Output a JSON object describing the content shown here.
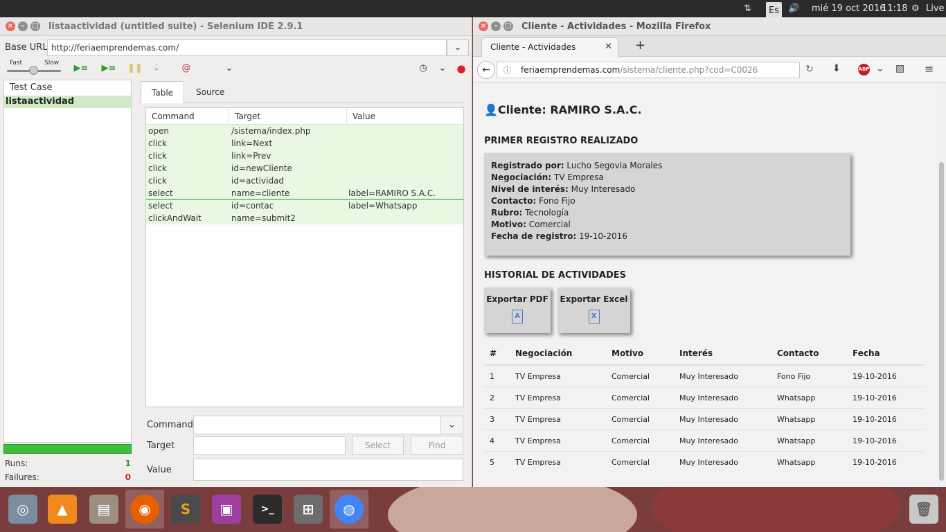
{
  "top_panel": {
    "keyboard": "Es",
    "date": "mié 19 oct 2016",
    "time": "11:18",
    "live": "Live"
  },
  "selenium": {
    "title": "listaactividad (untitled suite) - Selenium IDE 2.9.1",
    "base_url_label": "Base URL",
    "base_url": "http://feriaemprendemas.com/",
    "speed_fast": "Fast",
    "speed_slow": "Slow",
    "testcase_header": "Test Case",
    "testcase_item": "listaactividad",
    "runs_label": "Runs:",
    "runs_value": "1",
    "failures_label": "Failures:",
    "failures_value": "0",
    "tabs": [
      {
        "label": "Table"
      },
      {
        "label": "Source"
      }
    ],
    "columns": [
      "Command",
      "Target",
      "Value"
    ],
    "commands": [
      {
        "command": "open",
        "target": "/sistema/index.php",
        "value": ""
      },
      {
        "command": "click",
        "target": "link=Next",
        "value": ""
      },
      {
        "command": "click",
        "target": "link=Prev",
        "value": ""
      },
      {
        "command": "click",
        "target": "id=newCliente",
        "value": ""
      },
      {
        "command": "click",
        "target": "id=actividad",
        "value": ""
      },
      {
        "command": "select",
        "target": "name=cliente",
        "value": "label=RAMIRO S.A.C."
      },
      {
        "command": "select",
        "target": "id=contac",
        "value": "label=Whatsapp"
      },
      {
        "command": "clickAndWait",
        "target": "name=submit2",
        "value": ""
      }
    ],
    "form": {
      "command_label": "Command",
      "target_label": "Target",
      "value_label": "Value",
      "select_button": "Select",
      "find_button": "Find"
    }
  },
  "firefox": {
    "title": "Cliente - Actividades - Mozilla Firefox",
    "tab_label": "Cliente - Actividades",
    "url_host": "feriaemprendemas.com",
    "url_path": "/sistema/cliente.php?cod=C0026",
    "adblock": "ABP"
  },
  "page": {
    "client_title": "Cliente: RAMIRO S.A.C.",
    "first_record_heading": "PRIMER REGISTRO REALIZADO",
    "fields": [
      {
        "label": "Registrado por:",
        "value": "Lucho Segovia Morales"
      },
      {
        "label": "Negociación:",
        "value": "TV Empresa"
      },
      {
        "label": "Nivel de interés:",
        "value": "Muy Interesado"
      },
      {
        "label": "Contacto:",
        "value": "Fono Fijo"
      },
      {
        "label": "Rubro:",
        "value": "Tecnología"
      },
      {
        "label": "Motivo:",
        "value": "Comercial"
      },
      {
        "label": "Fecha de registro:",
        "value": "19-10-2016"
      }
    ],
    "history_heading": "HISTORIAL DE ACTIVIDADES",
    "export_pdf": "Exportar PDF",
    "export_excel": "Exportar Excel",
    "pdf_glyph": "A",
    "excel_glyph": "X",
    "table_headers": [
      "#",
      "Negociación",
      "Motivo",
      "Interés",
      "Contacto",
      "Fecha"
    ],
    "rows": [
      [
        "1",
        "TV Empresa",
        "Comercial",
        "Muy Interesado",
        "Fono Fijo",
        "19-10-2016"
      ],
      [
        "2",
        "TV Empresa",
        "Comercial",
        "Muy Interesado",
        "Whatsapp",
        "19-10-2016"
      ],
      [
        "3",
        "TV Empresa",
        "Comercial",
        "Muy Interesado",
        "Whatsapp",
        "19-10-2016"
      ],
      [
        "4",
        "TV Empresa",
        "Comercial",
        "Muy Interesado",
        "Whatsapp",
        "19-10-2016"
      ],
      [
        "5",
        "TV Empresa",
        "Comercial",
        "Muy Interesado",
        "Whatsapp",
        "19-10-2016"
      ]
    ]
  },
  "dock": [
    {
      "name": "ubuntu-icon",
      "color": "#7a8ea0",
      "glyph": "◎"
    },
    {
      "name": "vlc-icon",
      "color": "#f08a1c",
      "glyph": "▲"
    },
    {
      "name": "files-icon",
      "color": "#9a8f82",
      "glyph": "▤"
    },
    {
      "name": "firefox-icon",
      "color": "#e66000",
      "glyph": "◉"
    },
    {
      "name": "sublime-icon",
      "color": "#4a4a4a",
      "glyph": "S"
    },
    {
      "name": "app-window-icon",
      "color": "#9c3fa0",
      "glyph": "▣"
    },
    {
      "name": "terminal-icon",
      "color": "#2b2b2b",
      "glyph": ">_"
    },
    {
      "name": "workspaces-icon",
      "color": "#6d6d6d",
      "glyph": "⊞"
    },
    {
      "name": "chrome-icon",
      "color": "#4285f4",
      "glyph": "◍"
    }
  ]
}
